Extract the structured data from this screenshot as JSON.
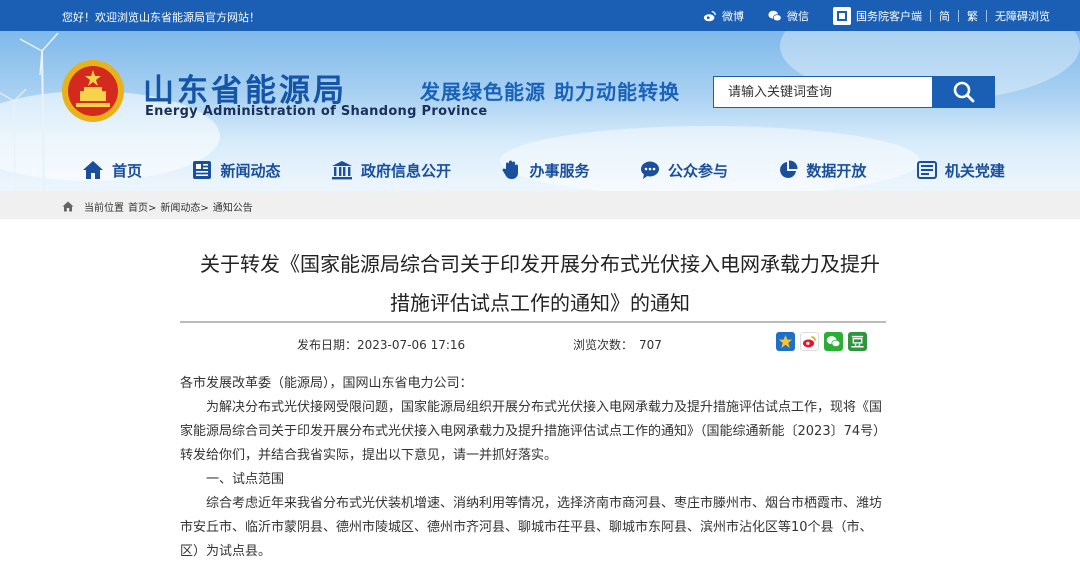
{
  "topbar": {
    "greeting": "您好！欢迎浏览山东省能源局官方网站！",
    "weibo": "微博",
    "wechat": "微信",
    "gov_app": "国务院客户端",
    "simplified": "简",
    "traditional": "繁",
    "accessibility": "无障碍浏览"
  },
  "header": {
    "site_name_cn": "山东省能源局",
    "site_name_en": "Energy Administration of Shandong Province",
    "slogan": "发展绿色能源  助力动能转换",
    "search_placeholder": "请输入关键词查询"
  },
  "nav": [
    {
      "label": "首页",
      "icon": "home-icon"
    },
    {
      "label": "新闻动态",
      "icon": "news-icon"
    },
    {
      "label": "政府信息公开",
      "icon": "government-icon"
    },
    {
      "label": "办事服务",
      "icon": "service-icon"
    },
    {
      "label": "公众参与",
      "icon": "chat-icon"
    },
    {
      "label": "数据开放",
      "icon": "chart-icon"
    },
    {
      "label": "机关党建",
      "icon": "party-icon"
    }
  ],
  "breadcrumb": {
    "prefix": "当前位置",
    "items": [
      "首页>",
      "新闻动态>",
      "通知公告"
    ]
  },
  "article": {
    "title_line1": "关于转发《国家能源局综合司关于印发开展分布式光伏接入电网承载力及提升",
    "title_line2": "措施评估试点工作的通知》的通知",
    "publish_label": "发布日期：",
    "publish_date": "2023-07-06 17:16",
    "views_label": "浏览次数：",
    "views": "707",
    "paragraphs": [
      "各市发展改革委（能源局），国网山东省电力公司：",
      "为解决分布式光伏接网受限问题，国家能源局组织开展分布式光伏接入电网承载力及提升措施评估试点工作，现将《国家能源局综合司关于印发开展分布式光伏接入电网承载力及提升措施评估试点工作的通知》（国能综通新能〔2023〕74号）转发给你们，并结合我省实际，提出以下意见，请一并抓好落实。",
      "一、试点范围",
      "综合考虑近年来我省分布式光伏装机增速、消纳利用等情况，选择济南市商河县、枣庄市滕州市、烟台市栖霞市、潍坊市安丘市、临沂市蒙阴县、德州市陵城区、德州市齐河县、聊城市茌平县、聊城市东阿县、滨州市沾化区等10个县（市、区）为试点县。"
    ]
  },
  "share": [
    "qzone-icon",
    "weibo-share-icon",
    "wechat-share-icon",
    "douban-icon"
  ],
  "colors": {
    "brand_blue": "#1a5fb4",
    "nav_text": "#1a4f9c"
  }
}
